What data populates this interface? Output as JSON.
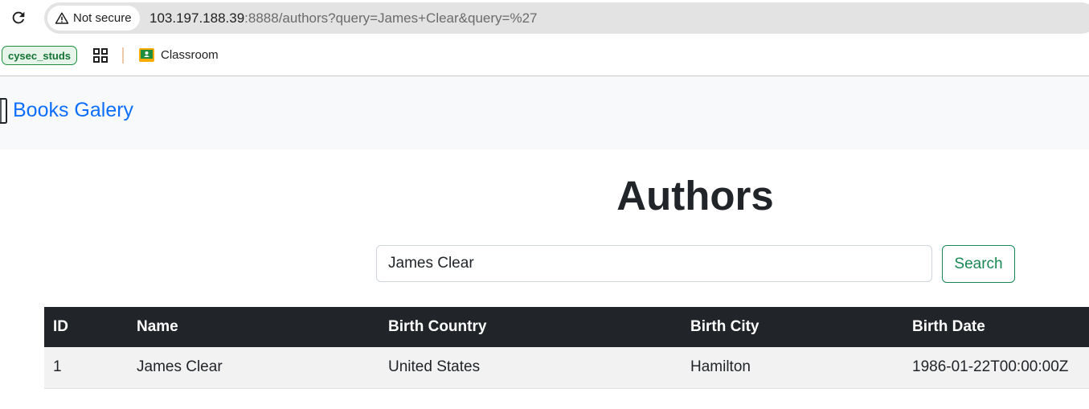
{
  "browser": {
    "security_chip": "Not secure",
    "url_host": "103.197.188.39",
    "url_rest": ":8888/authors?query=James+Clear&query=%27"
  },
  "bookmarks": {
    "profile_label": "cysec_studs",
    "items": [
      {
        "label": "Classroom",
        "icon": "classroom-icon"
      }
    ]
  },
  "navbar": {
    "brand": "Books Galery",
    "brand_icon": "book-icon"
  },
  "main": {
    "title": "Authors",
    "search_value": "James Clear",
    "search_button": "Search"
  },
  "table": {
    "headers": [
      "ID",
      "Name",
      "Birth Country",
      "Birth City",
      "Birth Date"
    ],
    "rows": [
      [
        "1",
        "James Clear",
        "United States",
        "Hamilton",
        "1986-01-22T00:00:00Z"
      ]
    ]
  },
  "colors": {
    "brand": "#0d6efd",
    "success": "#198754",
    "table_header": "#212529",
    "navbar_bg": "#f8f9fa"
  }
}
